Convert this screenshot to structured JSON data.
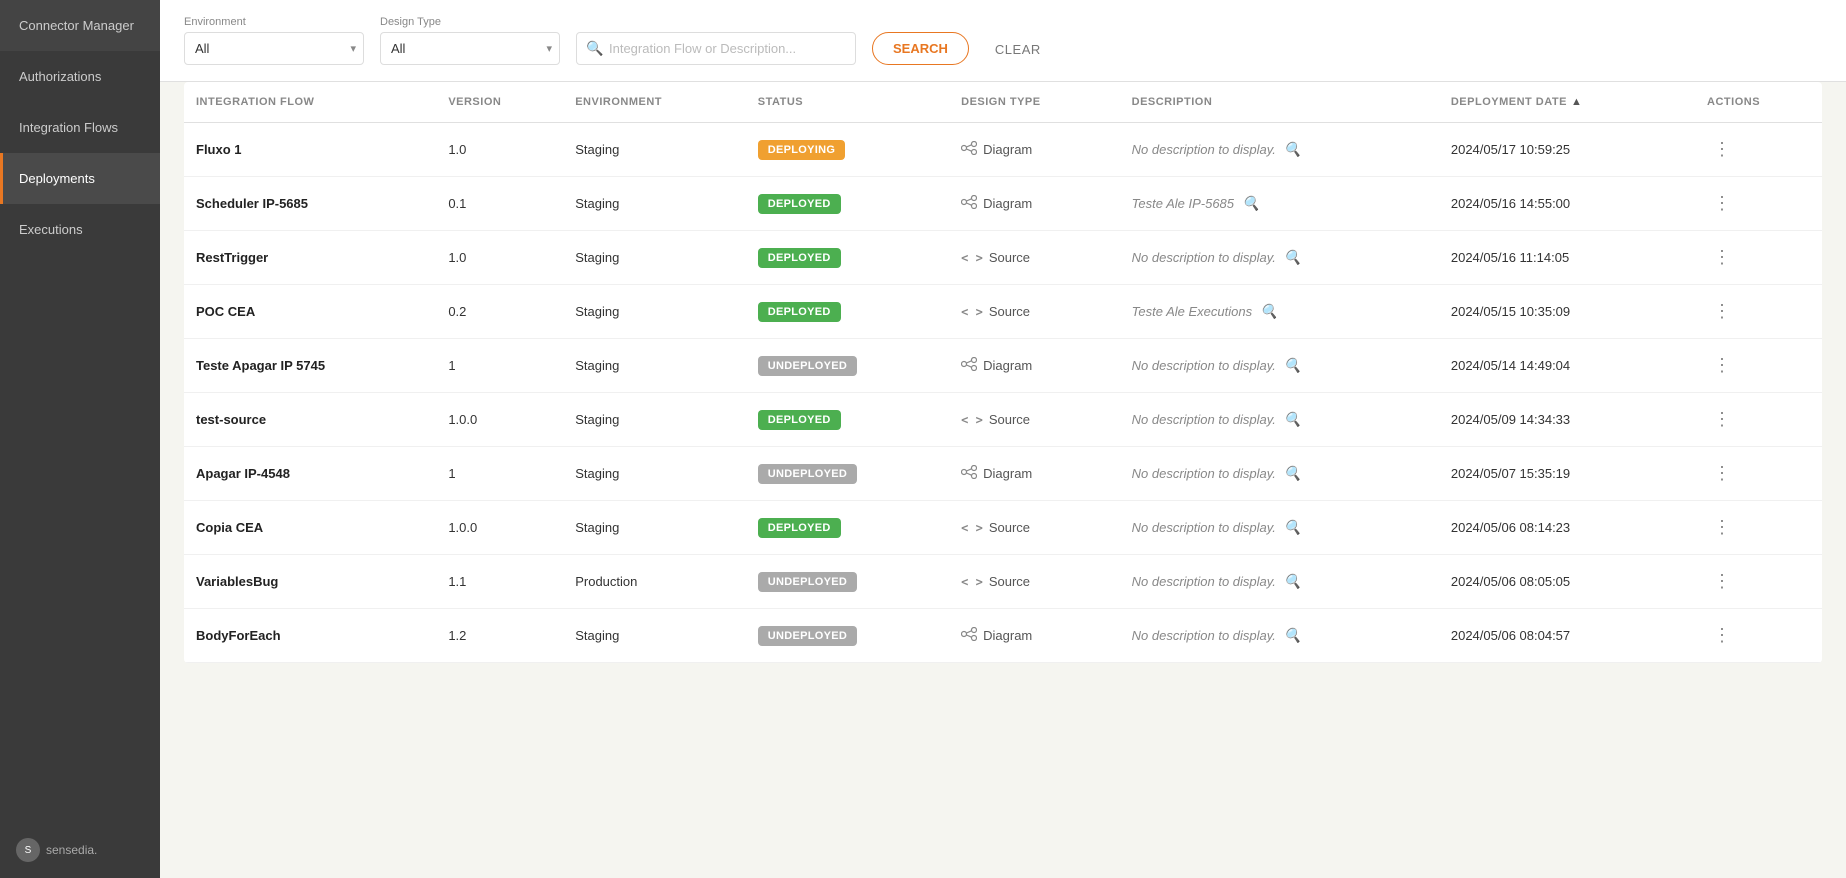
{
  "sidebar": {
    "title": "Connector Manager",
    "items": [
      {
        "id": "connector-manager",
        "label": "Connector Manager",
        "active": false
      },
      {
        "id": "authorizations",
        "label": "Authorizations",
        "active": false
      },
      {
        "id": "integration-flows",
        "label": "Integration Flows",
        "active": false
      },
      {
        "id": "deployments",
        "label": "Deployments",
        "active": true
      },
      {
        "id": "executions",
        "label": "Executions",
        "active": false
      }
    ],
    "logo": {
      "text": "sensedia.",
      "icon": "S"
    }
  },
  "toolbar": {
    "environment_label": "Environment",
    "environment_value": "All",
    "design_type_label": "Design Type",
    "design_type_value": "All",
    "search_placeholder": "Integration Flow or Description...",
    "search_button": "SEARCH",
    "clear_button": "CLEAR"
  },
  "table": {
    "columns": [
      {
        "id": "integration-flow",
        "label": "INTEGRATION FLOW",
        "sortable": false
      },
      {
        "id": "version",
        "label": "VERSION",
        "sortable": false
      },
      {
        "id": "environment",
        "label": "ENVIRONMENT",
        "sortable": false
      },
      {
        "id": "status",
        "label": "STATUS",
        "sortable": false
      },
      {
        "id": "design-type",
        "label": "DESIGN TYPE",
        "sortable": false
      },
      {
        "id": "description",
        "label": "DESCRIPTION",
        "sortable": false
      },
      {
        "id": "deployment-date",
        "label": "DEPLOYMENT DATE",
        "sortable": true
      },
      {
        "id": "actions",
        "label": "ACTIONS",
        "sortable": false
      }
    ],
    "rows": [
      {
        "name": "Fluxo 1",
        "version": "1.0",
        "environment": "Staging",
        "status": "DEPLOYING",
        "status_class": "status-deploying",
        "design_type": "Diagram",
        "design_icon": "diagram",
        "description": "No description to display.",
        "deployment_date": "2024/05/17 10:59:25"
      },
      {
        "name": "Scheduler IP-5685",
        "version": "0.1",
        "environment": "Staging",
        "status": "DEPLOYED",
        "status_class": "status-deployed",
        "design_type": "Diagram",
        "design_icon": "diagram",
        "description": "Teste Ale IP-5685",
        "deployment_date": "2024/05/16 14:55:00"
      },
      {
        "name": "RestTrigger",
        "version": "1.0",
        "environment": "Staging",
        "status": "DEPLOYED",
        "status_class": "status-deployed",
        "design_type": "Source",
        "design_icon": "source",
        "description": "No description to display.",
        "deployment_date": "2024/05/16 11:14:05"
      },
      {
        "name": "POC CEA",
        "version": "0.2",
        "environment": "Staging",
        "status": "DEPLOYED",
        "status_class": "status-deployed",
        "design_type": "Source",
        "design_icon": "source",
        "description": "Teste Ale Executions",
        "deployment_date": "2024/05/15 10:35:09"
      },
      {
        "name": "Teste Apagar IP 5745",
        "version": "1",
        "environment": "Staging",
        "status": "UNDEPLOYED",
        "status_class": "status-undeployed",
        "design_type": "Diagram",
        "design_icon": "diagram",
        "description": "No description to display.",
        "deployment_date": "2024/05/14 14:49:04"
      },
      {
        "name": "test-source",
        "version": "1.0.0",
        "environment": "Staging",
        "status": "DEPLOYED",
        "status_class": "status-deployed",
        "design_type": "Source",
        "design_icon": "source",
        "description": "No description to display.",
        "deployment_date": "2024/05/09 14:34:33"
      },
      {
        "name": "Apagar IP-4548",
        "version": "1",
        "environment": "Staging",
        "status": "UNDEPLOYED",
        "status_class": "status-undeployed",
        "design_type": "Diagram",
        "design_icon": "diagram",
        "description": "No description to display.",
        "deployment_date": "2024/05/07 15:35:19"
      },
      {
        "name": "Copia CEA",
        "version": "1.0.0",
        "environment": "Staging",
        "status": "DEPLOYED",
        "status_class": "status-deployed",
        "design_type": "Source",
        "design_icon": "source",
        "description": "No description to display.",
        "deployment_date": "2024/05/06 08:14:23"
      },
      {
        "name": "VariablesBug",
        "version": "1.1",
        "environment": "Production",
        "status": "UNDEPLOYED",
        "status_class": "status-undeployed",
        "design_type": "Source",
        "design_icon": "source",
        "description": "No description to display.",
        "deployment_date": "2024/05/06 08:05:05"
      },
      {
        "name": "BodyForEach",
        "version": "1.2",
        "environment": "Staging",
        "status": "UNDEPLOYED",
        "status_class": "status-undeployed",
        "design_type": "Diagram",
        "design_icon": "diagram",
        "description": "No description to display.",
        "deployment_date": "2024/05/06 08:04:57"
      }
    ]
  }
}
